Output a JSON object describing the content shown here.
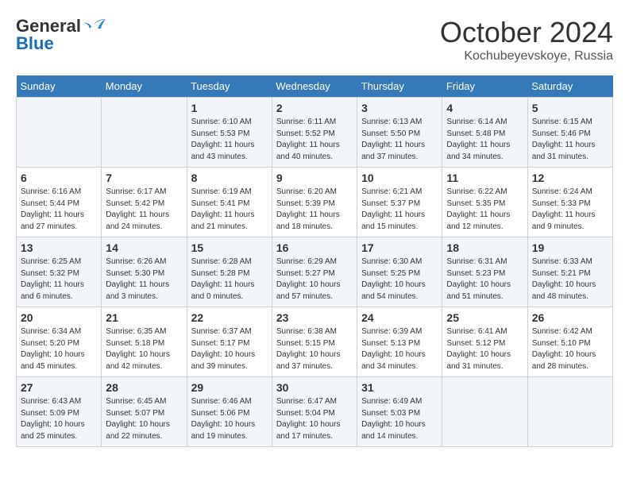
{
  "header": {
    "logo_general": "General",
    "logo_blue": "Blue",
    "month_year": "October 2024",
    "location": "Kochubeyevskoye, Russia"
  },
  "calendar": {
    "days_of_week": [
      "Sunday",
      "Monday",
      "Tuesday",
      "Wednesday",
      "Thursday",
      "Friday",
      "Saturday"
    ],
    "weeks": [
      [
        {
          "day": "",
          "info": ""
        },
        {
          "day": "",
          "info": ""
        },
        {
          "day": "1",
          "info": "Sunrise: 6:10 AM\nSunset: 5:53 PM\nDaylight: 11 hours and 43 minutes."
        },
        {
          "day": "2",
          "info": "Sunrise: 6:11 AM\nSunset: 5:52 PM\nDaylight: 11 hours and 40 minutes."
        },
        {
          "day": "3",
          "info": "Sunrise: 6:13 AM\nSunset: 5:50 PM\nDaylight: 11 hours and 37 minutes."
        },
        {
          "day": "4",
          "info": "Sunrise: 6:14 AM\nSunset: 5:48 PM\nDaylight: 11 hours and 34 minutes."
        },
        {
          "day": "5",
          "info": "Sunrise: 6:15 AM\nSunset: 5:46 PM\nDaylight: 11 hours and 31 minutes."
        }
      ],
      [
        {
          "day": "6",
          "info": "Sunrise: 6:16 AM\nSunset: 5:44 PM\nDaylight: 11 hours and 27 minutes."
        },
        {
          "day": "7",
          "info": "Sunrise: 6:17 AM\nSunset: 5:42 PM\nDaylight: 11 hours and 24 minutes."
        },
        {
          "day": "8",
          "info": "Sunrise: 6:19 AM\nSunset: 5:41 PM\nDaylight: 11 hours and 21 minutes."
        },
        {
          "day": "9",
          "info": "Sunrise: 6:20 AM\nSunset: 5:39 PM\nDaylight: 11 hours and 18 minutes."
        },
        {
          "day": "10",
          "info": "Sunrise: 6:21 AM\nSunset: 5:37 PM\nDaylight: 11 hours and 15 minutes."
        },
        {
          "day": "11",
          "info": "Sunrise: 6:22 AM\nSunset: 5:35 PM\nDaylight: 11 hours and 12 minutes."
        },
        {
          "day": "12",
          "info": "Sunrise: 6:24 AM\nSunset: 5:33 PM\nDaylight: 11 hours and 9 minutes."
        }
      ],
      [
        {
          "day": "13",
          "info": "Sunrise: 6:25 AM\nSunset: 5:32 PM\nDaylight: 11 hours and 6 minutes."
        },
        {
          "day": "14",
          "info": "Sunrise: 6:26 AM\nSunset: 5:30 PM\nDaylight: 11 hours and 3 minutes."
        },
        {
          "day": "15",
          "info": "Sunrise: 6:28 AM\nSunset: 5:28 PM\nDaylight: 11 hours and 0 minutes."
        },
        {
          "day": "16",
          "info": "Sunrise: 6:29 AM\nSunset: 5:27 PM\nDaylight: 10 hours and 57 minutes."
        },
        {
          "day": "17",
          "info": "Sunrise: 6:30 AM\nSunset: 5:25 PM\nDaylight: 10 hours and 54 minutes."
        },
        {
          "day": "18",
          "info": "Sunrise: 6:31 AM\nSunset: 5:23 PM\nDaylight: 10 hours and 51 minutes."
        },
        {
          "day": "19",
          "info": "Sunrise: 6:33 AM\nSunset: 5:21 PM\nDaylight: 10 hours and 48 minutes."
        }
      ],
      [
        {
          "day": "20",
          "info": "Sunrise: 6:34 AM\nSunset: 5:20 PM\nDaylight: 10 hours and 45 minutes."
        },
        {
          "day": "21",
          "info": "Sunrise: 6:35 AM\nSunset: 5:18 PM\nDaylight: 10 hours and 42 minutes."
        },
        {
          "day": "22",
          "info": "Sunrise: 6:37 AM\nSunset: 5:17 PM\nDaylight: 10 hours and 39 minutes."
        },
        {
          "day": "23",
          "info": "Sunrise: 6:38 AM\nSunset: 5:15 PM\nDaylight: 10 hours and 37 minutes."
        },
        {
          "day": "24",
          "info": "Sunrise: 6:39 AM\nSunset: 5:13 PM\nDaylight: 10 hours and 34 minutes."
        },
        {
          "day": "25",
          "info": "Sunrise: 6:41 AM\nSunset: 5:12 PM\nDaylight: 10 hours and 31 minutes."
        },
        {
          "day": "26",
          "info": "Sunrise: 6:42 AM\nSunset: 5:10 PM\nDaylight: 10 hours and 28 minutes."
        }
      ],
      [
        {
          "day": "27",
          "info": "Sunrise: 6:43 AM\nSunset: 5:09 PM\nDaylight: 10 hours and 25 minutes."
        },
        {
          "day": "28",
          "info": "Sunrise: 6:45 AM\nSunset: 5:07 PM\nDaylight: 10 hours and 22 minutes."
        },
        {
          "day": "29",
          "info": "Sunrise: 6:46 AM\nSunset: 5:06 PM\nDaylight: 10 hours and 19 minutes."
        },
        {
          "day": "30",
          "info": "Sunrise: 6:47 AM\nSunset: 5:04 PM\nDaylight: 10 hours and 17 minutes."
        },
        {
          "day": "31",
          "info": "Sunrise: 6:49 AM\nSunset: 5:03 PM\nDaylight: 10 hours and 14 minutes."
        },
        {
          "day": "",
          "info": ""
        },
        {
          "day": "",
          "info": ""
        }
      ]
    ]
  }
}
